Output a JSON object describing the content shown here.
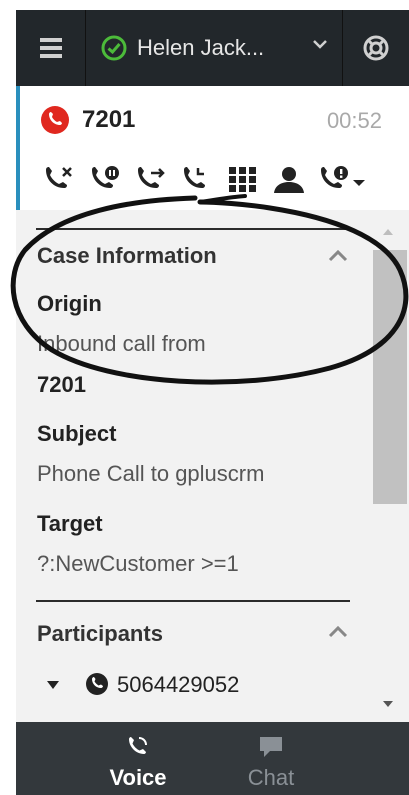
{
  "topbar": {
    "agent_name": "Helen Jack...",
    "icons": {
      "menu": "hamburger-icon",
      "status": "check-circle-icon",
      "dropdown": "chevron-down-icon",
      "support": "lifebuoy-icon"
    }
  },
  "call": {
    "number": "7201",
    "timer": "00:52",
    "actions": [
      "end-call-icon",
      "hold-call-icon",
      "transfer-call-icon",
      "consult-call-icon",
      "keypad-icon",
      "contact-icon",
      "voicemail-icon",
      "more-dropdown-icon"
    ]
  },
  "case_info": {
    "title": "Case Information",
    "origin_label": "Origin",
    "origin_value": "Inbound call from",
    "origin_number": "7201",
    "subject_label": "Subject",
    "subject_value": "Phone Call to gpluscrm",
    "target_label": "Target",
    "target_value": "?:NewCustomer >=1"
  },
  "participants": {
    "title": "Participants",
    "number": "5064429052"
  },
  "tabs": [
    {
      "label": "Voice",
      "icon": "phone-icon"
    },
    {
      "label": "Chat",
      "icon": "chat-bubble-icon"
    }
  ],
  "colors": {
    "topbar": "#22272b",
    "accent": "#2a8fbd",
    "status_green": "#4cbb3a",
    "call_red": "#e0281f",
    "tabs_bg": "#33383c"
  }
}
